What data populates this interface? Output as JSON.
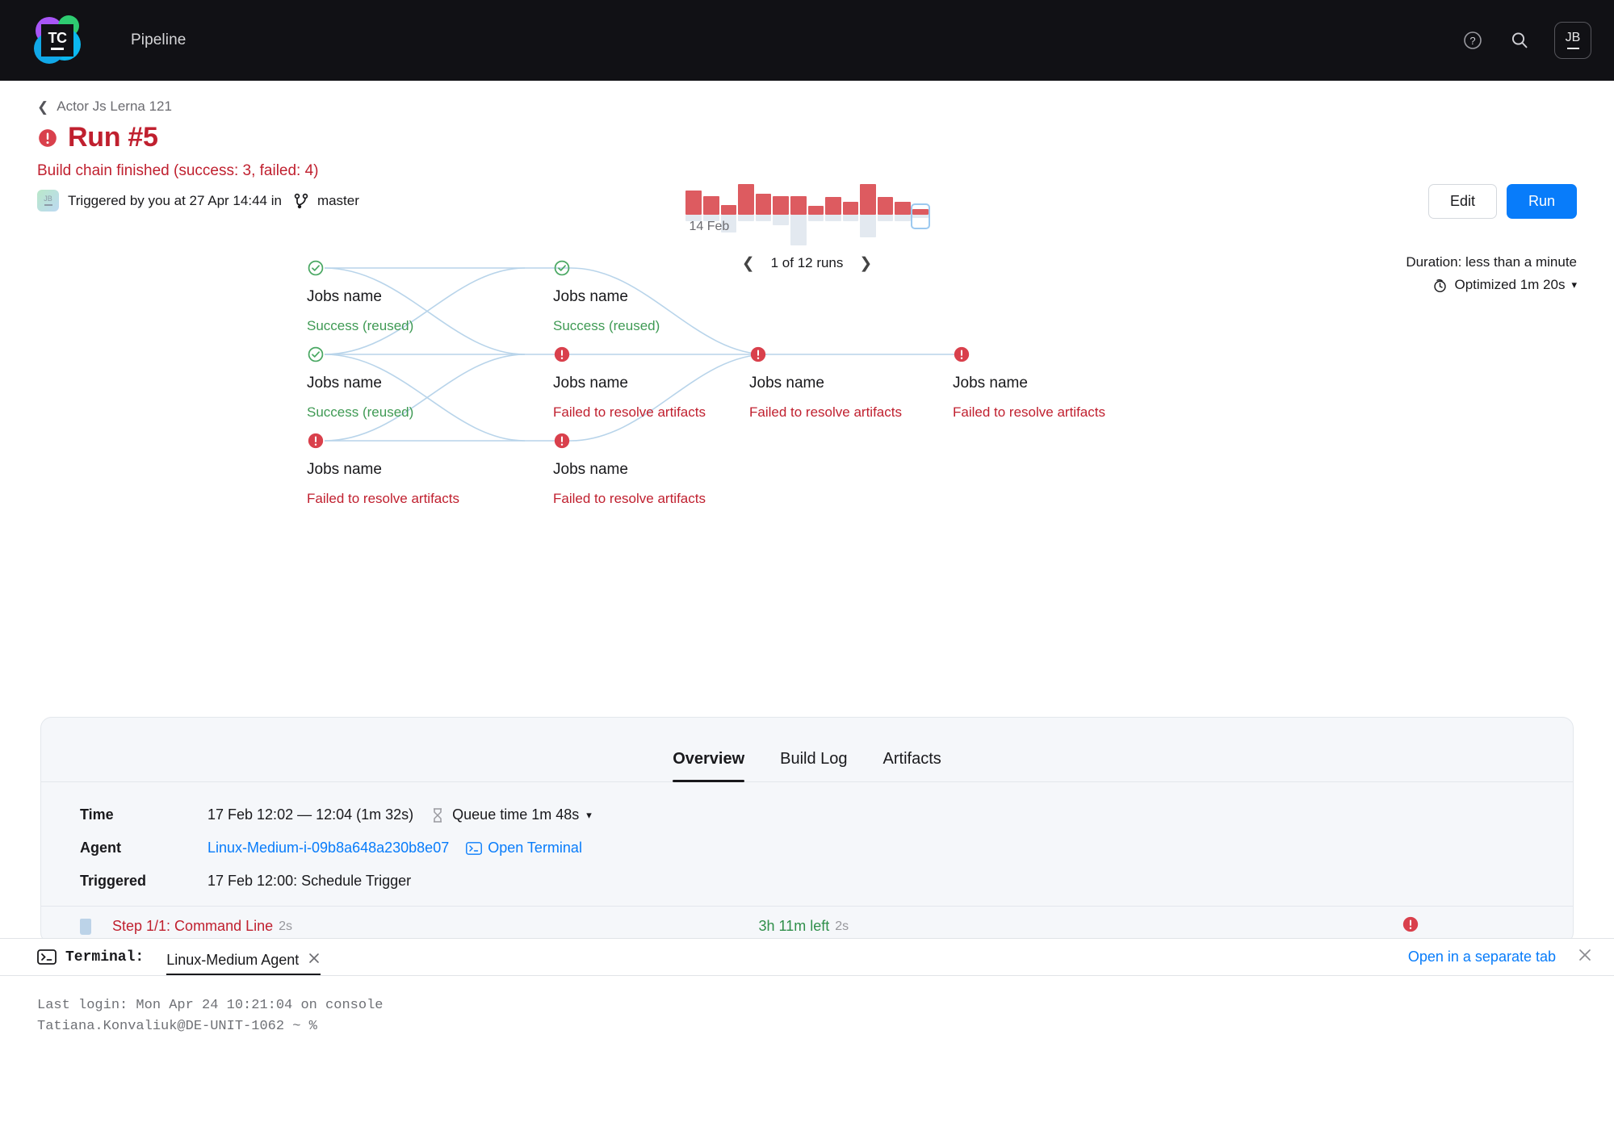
{
  "topnav": {
    "logo_text": "TC",
    "title": "Pipeline",
    "help_icon": "help-circle-icon",
    "search_icon": "search-icon",
    "avatar_initials": "JB"
  },
  "header": {
    "breadcrumb": "Actor Js Lerna 121",
    "run_title": "Run #5",
    "status_message": "Build chain finished (success: 3, failed: 4)",
    "triggered_by": "Triggered by you at 27 Apr 14:44 in",
    "branch": "master",
    "trigger_avatar": "JB",
    "edit_label": "Edit",
    "run_label": "Run",
    "duration_label": "Duration: less than a minute",
    "optimized_label": "Optimized 1m 20s",
    "accent_blue": "#087cfa",
    "error_red": "#c0202f",
    "success_green": "#3f9a54"
  },
  "runs_chart": {
    "date_label": "14 Feb",
    "pagination": "1 of 12 runs",
    "prev_icon": "chevron-left-icon",
    "next_icon": "chevron-right-icon",
    "bar_color": "#dd5b60",
    "queue_color": "#e3e9f0",
    "selected_index": 15,
    "bars": [
      {
        "up": 30,
        "down": 8
      },
      {
        "up": 23,
        "down": 8
      },
      {
        "up": 12,
        "down": 22
      },
      {
        "up": 38,
        "down": 8
      },
      {
        "up": 26,
        "down": 8
      },
      {
        "up": 23,
        "down": 13
      },
      {
        "up": 23,
        "down": 38
      },
      {
        "up": 11,
        "down": 8
      },
      {
        "up": 22,
        "down": 8
      },
      {
        "up": 16,
        "down": 8
      },
      {
        "up": 38,
        "down": 28
      },
      {
        "up": 22,
        "down": 8
      },
      {
        "up": 16,
        "down": 8
      },
      {
        "up": 7,
        "down": 4
      }
    ]
  },
  "graph": {
    "nodes": [
      {
        "name": "Jobs name",
        "status": "Success (reused)",
        "state": "ok",
        "col": 0,
        "row": 0
      },
      {
        "name": "Jobs name",
        "status": "Success (reused)",
        "state": "ok",
        "col": 0,
        "row": 1
      },
      {
        "name": "Jobs name",
        "status": "Failed to resolve artifacts",
        "state": "fail",
        "col": 0,
        "row": 2
      },
      {
        "name": "Jobs name",
        "status": "Success (reused)",
        "state": "ok",
        "col": 1,
        "row": 0
      },
      {
        "name": "Jobs name",
        "status": "Failed to resolve artifacts",
        "state": "fail",
        "col": 1,
        "row": 1
      },
      {
        "name": "Jobs name",
        "status": "Failed to resolve artifacts",
        "state": "fail",
        "col": 1,
        "row": 2
      },
      {
        "name": "Jobs name",
        "status": "Failed to resolve artifacts",
        "state": "fail",
        "col": 2,
        "row": 1
      },
      {
        "name": "Jobs name",
        "status": "Failed to resolve artifacts",
        "state": "fail",
        "col": 3,
        "row": 1
      }
    ],
    "edge_color": "#b8d4ea"
  },
  "card": {
    "tabs": [
      {
        "label": "Overview",
        "active": true
      },
      {
        "label": "Build Log",
        "active": false
      },
      {
        "label": "Artifacts",
        "active": false
      }
    ],
    "details": [
      {
        "label": "Time",
        "value": "17 Feb 12:02 — 12:04 (1m 32s)",
        "extra": "Queue time 1m 48s",
        "extra_icon": "hourglass-icon",
        "chevron": true
      },
      {
        "label": "Agent",
        "value": "Linux-Medium-i-09b8a648a230b8e07",
        "link": true,
        "terminal_link": "Open Terminal"
      },
      {
        "label": "Triggered",
        "value": "17 Feb 12:00: Schedule Trigger"
      }
    ],
    "step": {
      "name": "Step 1/1: Command Line",
      "duration": "2s",
      "remaining": "3h 11m left",
      "remaining_duration": "2s"
    }
  },
  "terminal": {
    "label": "Terminal:",
    "tab_name": "Linux-Medium Agent",
    "open_separate": "Open in a separate tab",
    "close_icon": "close-icon",
    "lines": [
      "Last login: Mon Apr 24 10:21:04 on console",
      "Tatiana.Konvaliuk@DE-UNIT-1062 ~ %"
    ]
  }
}
